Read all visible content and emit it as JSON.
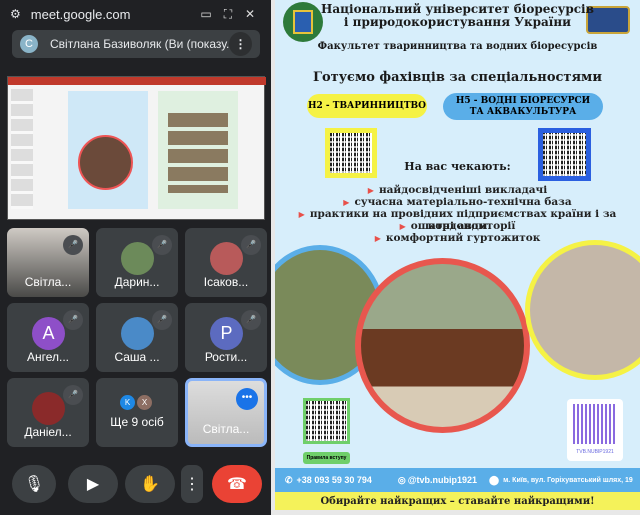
{
  "window": {
    "url": "meet.google.com"
  },
  "presenter": {
    "initial": "С",
    "label": "Світлана Базиволяк (Ви (показу..."
  },
  "tiles": [
    {
      "name": "Світла...",
      "type": "video"
    },
    {
      "name": "Дарин...",
      "type": "photo"
    },
    {
      "name": "Ісаков...",
      "type": "photo"
    },
    {
      "name": "Ангел...",
      "type": "letter",
      "initial": "A",
      "color": "#8e4fc8"
    },
    {
      "name": "Саша ...",
      "type": "photo"
    },
    {
      "name": "Рости...",
      "type": "letter",
      "initial": "P",
      "color": "#5c6bc0"
    },
    {
      "name": "Даніел...",
      "type": "photo"
    },
    {
      "name": "Ще 9 осіб",
      "type": "more",
      "initials": [
        "K",
        "X"
      ]
    },
    {
      "name": "Світла...",
      "type": "self"
    }
  ],
  "poster": {
    "university": [
      "Національний університет біоресурсів",
      "і природокористування України"
    ],
    "faculty": "Факультет тваринництва та водних біоресурсів",
    "headline": "Готуємо фахівців за спеціальностями",
    "spec1": "Н2  - ТВАРИННИЦТВО",
    "spec2": "Н5 - ВОДНІ БІОРЕСУРСИ ТА АКВАКУЛЬТУРА",
    "await": "На вас чекають:",
    "bullets": [
      "найдосвідченіші викладачі",
      "сучасна матеріально-технічна база",
      "практики на провідних підприємствах країни і за кордоном",
      "ошатні авдиторії",
      "комфортний гуртожиток"
    ],
    "rules_label": "Правила вступу",
    "insta_label": "TVB.NUBIP1921",
    "phone": "+38 093 59 30 794",
    "instagram": "@tvb.nubip1921",
    "address": "м. Київ, вул. Горіхуватський шлях, 19",
    "slogan": "Обирайте найкращих – ставайте  найкращими!"
  }
}
